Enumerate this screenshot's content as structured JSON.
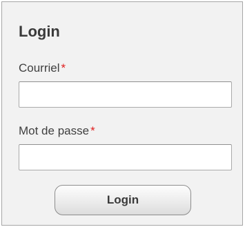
{
  "form": {
    "title": "Login",
    "email": {
      "label": "Courriel",
      "required_mark": "*",
      "value": "",
      "placeholder": ""
    },
    "password": {
      "label": "Mot de passe",
      "required_mark": "*",
      "value": "",
      "placeholder": ""
    },
    "submit_label": "Login"
  },
  "colors": {
    "panel_background": "#f2f2f2",
    "panel_border": "#a6a6a6",
    "required_mark": "#e02020",
    "text": "#3f3f3f"
  }
}
